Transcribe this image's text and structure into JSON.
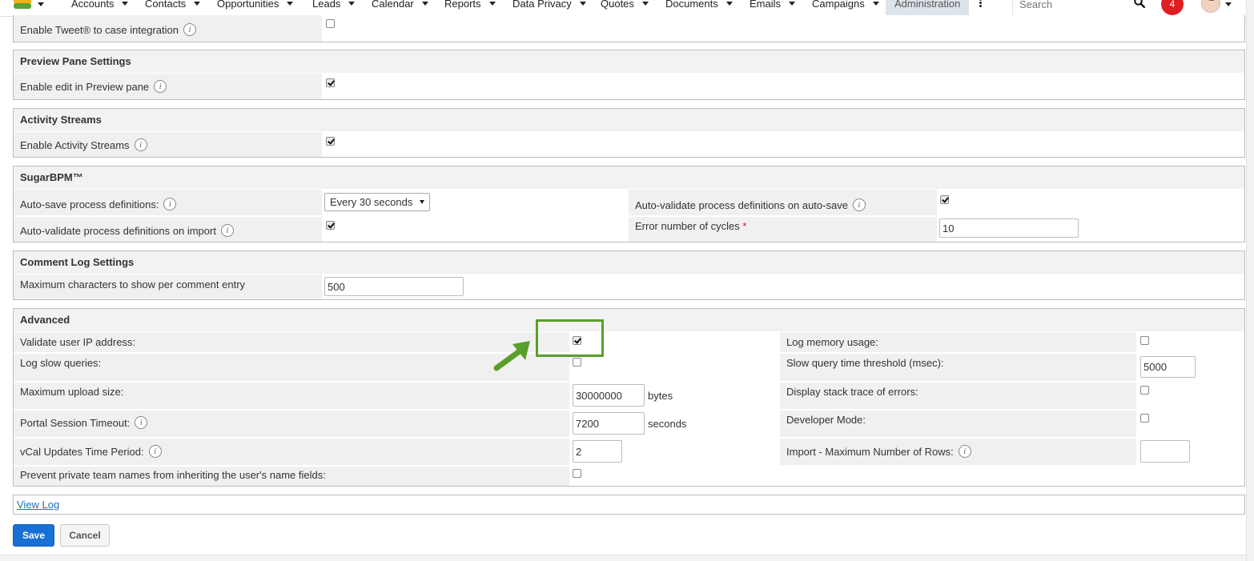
{
  "nav": {
    "items": [
      "Accounts",
      "Contacts",
      "Opportunities",
      "Leads",
      "Calendar",
      "Reports",
      "Data Privacy",
      "Quotes",
      "Documents",
      "Emails",
      "Campaigns"
    ],
    "active": "Administration",
    "search_placeholder": "Search",
    "notification_count": "4"
  },
  "tweet_row": {
    "label": "Enable Tweet® to case integration",
    "checked": false
  },
  "preview_pane": {
    "title": "Preview Pane Settings",
    "edit_label": "Enable edit in Preview pane",
    "edit_checked": true
  },
  "activity_streams": {
    "title": "Activity Streams",
    "enable_label": "Enable Activity Streams",
    "enable_checked": true
  },
  "sugarbpm": {
    "title": "SugarBPM™",
    "autosave_label": "Auto-save process definitions:",
    "autosave_value": "Every 30 seconds",
    "autovalidate_autosave_label": "Auto-validate process definitions on auto-save",
    "autovalidate_autosave_checked": true,
    "autovalidate_import_label": "Auto-validate process definitions on import",
    "autovalidate_import_checked": true,
    "error_cycles_label": "Error number of cycles",
    "error_cycles_required": "*",
    "error_cycles_value": "10"
  },
  "comment_log": {
    "title": "Comment Log Settings",
    "max_chars_label": "Maximum characters to show per comment entry",
    "max_chars_value": "500"
  },
  "advanced": {
    "title": "Advanced",
    "validate_ip_label": "Validate user IP address:",
    "validate_ip_checked": true,
    "log_memory_label": "Log memory usage:",
    "log_memory_checked": false,
    "log_slow_label": "Log slow queries:",
    "log_slow_checked": false,
    "slow_threshold_label": "Slow query time threshold (msec):",
    "slow_threshold_value": "5000",
    "max_upload_label": "Maximum upload size:",
    "max_upload_value": "30000000",
    "max_upload_unit": "bytes",
    "stack_trace_label": "Display stack trace of errors:",
    "stack_trace_checked": false,
    "portal_timeout_label": "Portal Session Timeout:",
    "portal_timeout_value": "7200",
    "portal_timeout_unit": "seconds",
    "developer_mode_label": "Developer Mode:",
    "developer_mode_checked": false,
    "vcal_label": "vCal Updates Time Period:",
    "vcal_value": "2",
    "import_max_rows_label": "Import - Maximum Number of Rows:",
    "import_max_rows_value": "",
    "private_team_label": "Prevent private team names from inheriting the user's name fields:",
    "private_team_checked": false
  },
  "view_log": "View Log",
  "buttons": {
    "save": "Save",
    "cancel": "Cancel"
  },
  "colors": {
    "accent": "#1870d5",
    "highlight": "#5a9e2b",
    "notification": "#e01e22"
  }
}
